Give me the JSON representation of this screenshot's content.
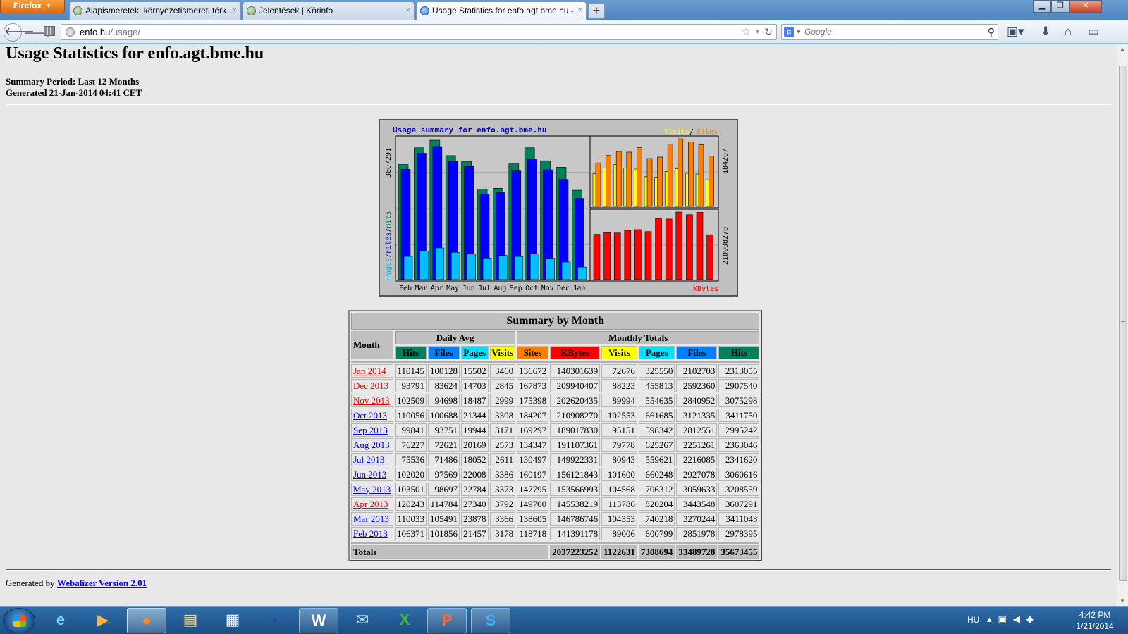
{
  "browser": {
    "menu_label": "Firefox",
    "tabs": [
      {
        "title": "Alapismeretek: környezetismereti térk...",
        "active": false
      },
      {
        "title": "Jelentések | Körinfo",
        "active": false
      },
      {
        "title": "Usage Statistics for enfo.agt.bme.hu -...",
        "active": true
      }
    ],
    "new_tab": "+",
    "close_glyph": "×",
    "url_host": "enfo.hu",
    "url_path": "/usage/",
    "search_placeholder": "Google"
  },
  "page": {
    "title": "Usage Statistics for enfo.agt.bme.hu",
    "summary_period": "Summary Period: Last 12 Months",
    "generated": "Generated 21-Jan-2014 04:41 CET",
    "footer_prefix": "Generated by ",
    "footer_link": "Webalizer Version 2.01"
  },
  "graph": {
    "title": "Usage summary for enfo.agt.bme.hu",
    "legend_visits": "Visits",
    "legend_sep": " / ",
    "legend_sites": "Sites",
    "left_legend_pages": "Pages",
    "left_legend_files": "Files",
    "left_legend_hits": "Hits",
    "left_axis_max": "3607291",
    "right_top_max": "184207",
    "right_bottom_max": "210908270",
    "kbytes_label": "KBytes",
    "colors": {
      "hits": "#00805c",
      "files": "#0000ff",
      "pages": "#00c0ff",
      "visits": "#ffff00",
      "sites": "#ff8000",
      "kbytes": "#ff0000"
    }
  },
  "chart_data": {
    "type": "bar",
    "title": "Usage summary for enfo.agt.bme.hu",
    "categories": [
      "Feb",
      "Mar",
      "Apr",
      "May",
      "Jun",
      "Jul",
      "Aug",
      "Sep",
      "Oct",
      "Nov",
      "Dec",
      "Jan"
    ],
    "series": [
      {
        "name": "Hits",
        "values": [
          2978395,
          3411043,
          3607291,
          3208559,
          3060616,
          2341620,
          2363046,
          2995242,
          3411750,
          3075298,
          2907540,
          2313055
        ]
      },
      {
        "name": "Files",
        "values": [
          2851978,
          3270244,
          3443548,
          3059633,
          2927078,
          2216085,
          2251261,
          2812551,
          3121335,
          2840952,
          2592360,
          2102703
        ]
      },
      {
        "name": "Pages",
        "values": [
          600799,
          740218,
          820204,
          706312,
          660248,
          559621,
          625267,
          598342,
          661685,
          554635,
          455813,
          325550
        ]
      },
      {
        "name": "Visits",
        "values": [
          89006,
          104353,
          113786,
          104568,
          101600,
          80943,
          79778,
          95151,
          102553,
          89994,
          88223,
          72676
        ]
      },
      {
        "name": "Sites",
        "values": [
          118718,
          138605,
          149700,
          147795,
          160197,
          130497,
          134347,
          169297,
          184207,
          175398,
          167873,
          136672
        ]
      },
      {
        "name": "KBytes",
        "values": [
          141391178,
          146786746,
          145538219,
          153566993,
          156121843,
          149922331,
          191107361,
          189017830,
          210908270,
          202620435,
          209940407,
          140301639
        ]
      }
    ]
  },
  "table": {
    "caption": "Summary by Month",
    "month_header": "Month",
    "daily_avg_header": "Daily Avg",
    "monthly_totals_header": "Monthly Totals",
    "daily_cols": [
      {
        "label": "Hits",
        "color": "#00805c"
      },
      {
        "label": "Files",
        "color": "#0080ff"
      },
      {
        "label": "Pages",
        "color": "#00e0ff"
      },
      {
        "label": "Visits",
        "color": "#ffff00"
      }
    ],
    "monthly_cols": [
      {
        "label": "Sites",
        "color": "#ff8000"
      },
      {
        "label": "KBytes",
        "color": "#ff0000"
      },
      {
        "label": "Visits",
        "color": "#ffff00"
      },
      {
        "label": "Pages",
        "color": "#00e0ff"
      },
      {
        "label": "Files",
        "color": "#0080ff"
      },
      {
        "label": "Hits",
        "color": "#00805c"
      }
    ],
    "rows": [
      {
        "month": "Jan 2014",
        "visited": true,
        "d_hits": "110145",
        "d_files": "100128",
        "d_pages": "15502",
        "d_visits": "3460",
        "sites": "136672",
        "kbytes": "140301639",
        "visits": "72676",
        "pages": "325550",
        "files": "2102703",
        "hits": "2313055"
      },
      {
        "month": "Dec 2013",
        "visited": true,
        "d_hits": "93791",
        "d_files": "83624",
        "d_pages": "14703",
        "d_visits": "2845",
        "sites": "167873",
        "kbytes": "209940407",
        "visits": "88223",
        "pages": "455813",
        "files": "2592360",
        "hits": "2907540"
      },
      {
        "month": "Nov 2013",
        "visited": true,
        "d_hits": "102509",
        "d_files": "94698",
        "d_pages": "18487",
        "d_visits": "2999",
        "sites": "175398",
        "kbytes": "202620435",
        "visits": "89994",
        "pages": "554635",
        "files": "2840952",
        "hits": "3075298"
      },
      {
        "month": "Oct 2013",
        "visited": false,
        "d_hits": "110056",
        "d_files": "100688",
        "d_pages": "21344",
        "d_visits": "3308",
        "sites": "184207",
        "kbytes": "210908270",
        "visits": "102553",
        "pages": "661685",
        "files": "3121335",
        "hits": "3411750"
      },
      {
        "month": "Sep 2013",
        "visited": false,
        "d_hits": "99841",
        "d_files": "93751",
        "d_pages": "19944",
        "d_visits": "3171",
        "sites": "169297",
        "kbytes": "189017830",
        "visits": "95151",
        "pages": "598342",
        "files": "2812551",
        "hits": "2995242"
      },
      {
        "month": "Aug 2013",
        "visited": false,
        "d_hits": "76227",
        "d_files": "72621",
        "d_pages": "20169",
        "d_visits": "2573",
        "sites": "134347",
        "kbytes": "191107361",
        "visits": "79778",
        "pages": "625267",
        "files": "2251261",
        "hits": "2363046"
      },
      {
        "month": "Jul 2013",
        "visited": false,
        "d_hits": "75536",
        "d_files": "71486",
        "d_pages": "18052",
        "d_visits": "2611",
        "sites": "130497",
        "kbytes": "149922331",
        "visits": "80943",
        "pages": "559621",
        "files": "2216085",
        "hits": "2341620"
      },
      {
        "month": "Jun 2013",
        "visited": false,
        "d_hits": "102020",
        "d_files": "97569",
        "d_pages": "22008",
        "d_visits": "3386",
        "sites": "160197",
        "kbytes": "156121843",
        "visits": "101600",
        "pages": "660248",
        "files": "2927078",
        "hits": "3060616"
      },
      {
        "month": "May 2013",
        "visited": false,
        "d_hits": "103501",
        "d_files": "98697",
        "d_pages": "22784",
        "d_visits": "3373",
        "sites": "147795",
        "kbytes": "153566993",
        "visits": "104568",
        "pages": "706312",
        "files": "3059633",
        "hits": "3208559"
      },
      {
        "month": "Apr 2013",
        "visited": true,
        "d_hits": "120243",
        "d_files": "114784",
        "d_pages": "27340",
        "d_visits": "3792",
        "sites": "149700",
        "kbytes": "145538219",
        "visits": "113786",
        "pages": "820204",
        "files": "3443548",
        "hits": "3607291"
      },
      {
        "month": "Mar 2013",
        "visited": false,
        "d_hits": "110033",
        "d_files": "105491",
        "d_pages": "23878",
        "d_visits": "3366",
        "sites": "138605",
        "kbytes": "146786746",
        "visits": "104353",
        "pages": "740218",
        "files": "3270244",
        "hits": "3411043"
      },
      {
        "month": "Feb 2013",
        "visited": false,
        "d_hits": "106371",
        "d_files": "101856",
        "d_pages": "21457",
        "d_visits": "3178",
        "sites": "118718",
        "kbytes": "141391178",
        "visits": "89006",
        "pages": "600799",
        "files": "2851978",
        "hits": "2978395"
      }
    ],
    "totals_label": "Totals",
    "totals": {
      "kbytes": "2037223252",
      "visits": "1122631",
      "pages": "7308694",
      "files": "33489728",
      "hits": "35673455"
    }
  },
  "taskbar": {
    "language": "HU",
    "time": "4:42 PM",
    "date": "1/21/2014",
    "apps": [
      "internet-explorer-icon",
      "media-player-icon",
      "firefox-icon",
      "explorer-icon",
      "control-panel-icon",
      "floppy-save-icon",
      "word-icon",
      "thunderbird-icon",
      "excel-icon",
      "powerpoint-icon",
      "skype-icon"
    ]
  }
}
